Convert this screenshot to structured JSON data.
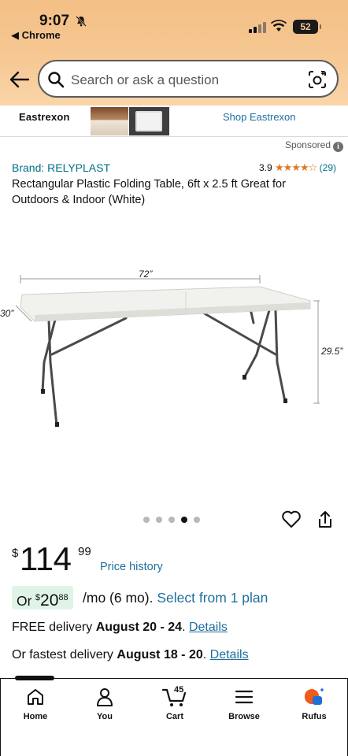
{
  "status_bar": {
    "time": "9:07",
    "back_app": "◀ Chrome",
    "battery": "52"
  },
  "search": {
    "placeholder": "Search or ask a question"
  },
  "sponsored_brand": {
    "logo": "Eastrexon",
    "link": "Shop Eastrexon"
  },
  "sponsored_label": "Sponsored",
  "product": {
    "brand": "Brand: RELYPLAST",
    "rating_value": "3.9",
    "stars": "★★★★☆",
    "review_count": "(29)",
    "title": "Rectangular Plastic Folding Table, 6ft x 2.5 ft Great for Outdoors & Indoor (White)",
    "image": {
      "dim_length": "72”",
      "dim_width": "30”",
      "dim_height": "29.5”"
    },
    "carousel": {
      "count": 5,
      "active_index": 3
    },
    "price": {
      "symbol": "$",
      "whole": "114",
      "fraction": "99"
    },
    "price_history_link": "Price history",
    "monthly": {
      "prefix": "Or",
      "symbol": "$",
      "whole": "20",
      "fraction": "88",
      "suffix": "/mo (6 mo).",
      "link": "Select from 1 plan"
    },
    "delivery": {
      "prefix": "FREE delivery",
      "dates": "August 20 - 24",
      "link": "Details"
    },
    "fastest": {
      "prefix": "Or fastest delivery",
      "dates": "August 18 - 20",
      "link": "Details"
    }
  },
  "tabbar": {
    "home": "Home",
    "you": "You",
    "cart": "Cart",
    "cart_count": "45",
    "browse": "Browse",
    "rufus": "Rufus"
  },
  "colors": {
    "header_gradient_top": "#f3bf86",
    "link": "#1f6f9f",
    "star": "#de7921",
    "monthly_bg": "#dff4e6"
  }
}
